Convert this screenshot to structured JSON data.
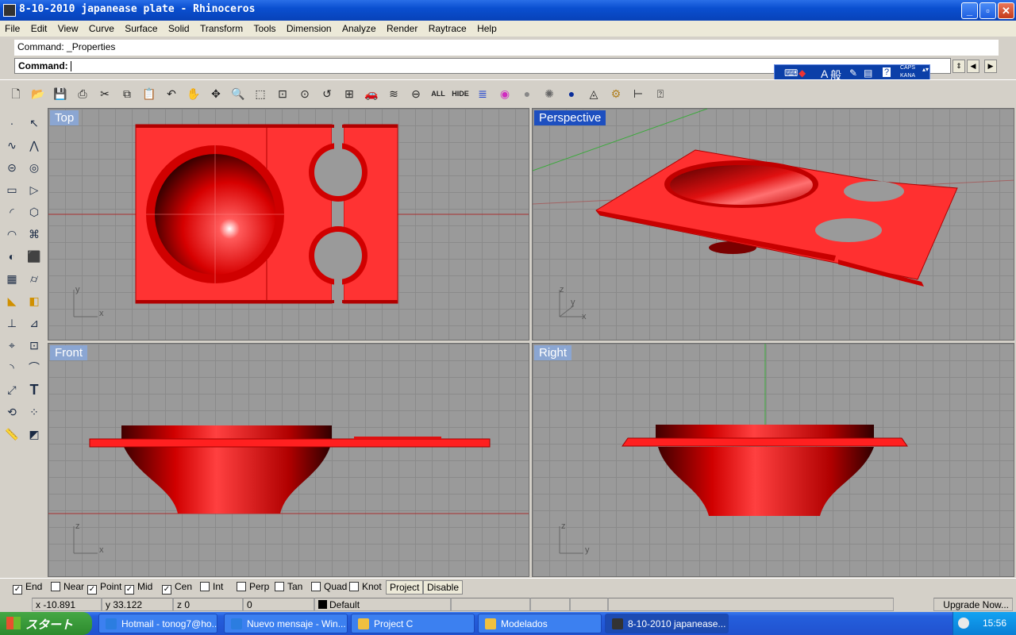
{
  "window": {
    "title": "8-10-2010 japanease plate - Rhinoceros",
    "minimize": "_",
    "maximize": "▫",
    "close": "✕"
  },
  "menu": [
    "File",
    "Edit",
    "View",
    "Curve",
    "Surface",
    "Solid",
    "Transform",
    "Tools",
    "Dimension",
    "Analyze",
    "Render",
    "Raytrace",
    "Help"
  ],
  "command": {
    "history": "Command: _Properties",
    "prompt": "Command:"
  },
  "ime": {
    "lang": "A",
    "mode": "般",
    "caps": "CAPS",
    "kana": "KANA"
  },
  "toolbar": {
    "all_label": "ALL",
    "hide_label": "HIDE"
  },
  "viewports": {
    "top": {
      "label": "Top",
      "axis_x": "x",
      "axis_y": "y"
    },
    "perspective": {
      "label": "Perspective",
      "axis_x": "x",
      "axis_y": "y",
      "axis_z": "z"
    },
    "front": {
      "label": "Front",
      "axis_x": "x",
      "axis_z": "z"
    },
    "right": {
      "label": "Right",
      "axis_y": "y",
      "axis_z": "z"
    }
  },
  "osnap": {
    "items": [
      {
        "label": "End",
        "checked": true
      },
      {
        "label": "Near",
        "checked": false
      },
      {
        "label": "Point",
        "checked": true
      },
      {
        "label": "Mid",
        "checked": true
      },
      {
        "label": "Cen",
        "checked": true
      },
      {
        "label": "Int",
        "checked": false
      },
      {
        "label": "Perp",
        "checked": false
      },
      {
        "label": "Tan",
        "checked": false
      },
      {
        "label": "Quad",
        "checked": false
      },
      {
        "label": "Knot",
        "checked": false
      }
    ],
    "project_label": "Project",
    "disable_label": "Disable"
  },
  "status": {
    "x": "x -10.891",
    "y": "y 33.122",
    "z": "z 0",
    "extra": "0",
    "layer": "Default",
    "upgrade": "Upgrade Now..."
  },
  "taskbar": {
    "start": "スタート",
    "tasks": [
      {
        "label": "Hotmail - tonog7@ho...",
        "color": "#2b7de0"
      },
      {
        "label": "Nuevo mensaje - Win...",
        "color": "#2b7de0"
      },
      {
        "label": "Project C",
        "color": "#f0c040"
      },
      {
        "label": "Modelados",
        "color": "#f0c040"
      },
      {
        "label": "8-10-2010 japanease...",
        "color": "#333333"
      }
    ],
    "clock": "15:56"
  },
  "colors": {
    "model": "#ff2b2b",
    "titlebar": "#0a4fd0",
    "viewport_bg": "#9a9a9a",
    "active_label": "#1d4fc0"
  }
}
